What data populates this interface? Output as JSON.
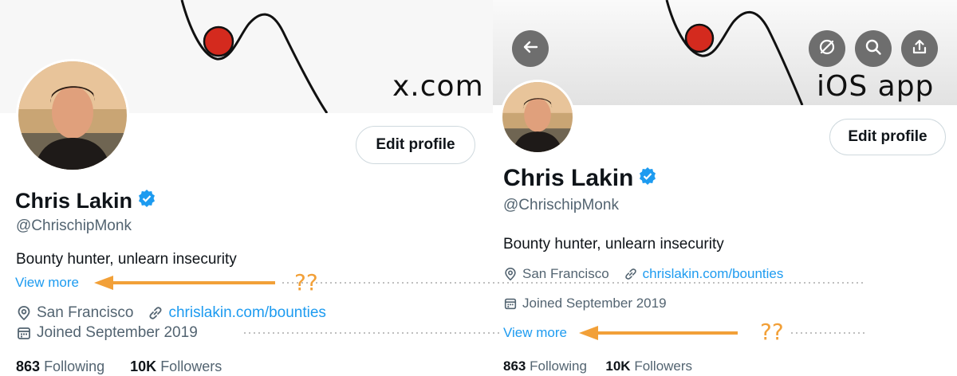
{
  "left": {
    "label": "x.com",
    "edit_label": "Edit profile",
    "name": "Chris Lakin",
    "handle": "@ChrischipMonk",
    "bio": "Bounty hunter, unlearn insecurity",
    "view_more": "View more",
    "location": "San Francisco",
    "link": "chrislakin.com/bounties",
    "joined": "Joined September 2019",
    "following_count": "863",
    "following_label": "Following",
    "followers_count": "10K",
    "followers_label": "Followers"
  },
  "right": {
    "label": "iOS app",
    "edit_label": "Edit profile",
    "name": "Chris Lakin",
    "handle": "@ChrischipMonk",
    "bio": "Bounty hunter, unlearn insecurity",
    "location": "San Francisco",
    "link": "chrislakin.com/bounties",
    "joined": "Joined September 2019",
    "view_more": "View more",
    "following_count": "863",
    "following_label": "Following",
    "followers_count": "10K",
    "followers_label": "Followers"
  },
  "annotation": {
    "marks": "??",
    "arrow_color": "#f2a038"
  },
  "colors": {
    "link": "#1d9bf0",
    "verified": "#1d9bf0",
    "ball": "#d42a1e"
  }
}
